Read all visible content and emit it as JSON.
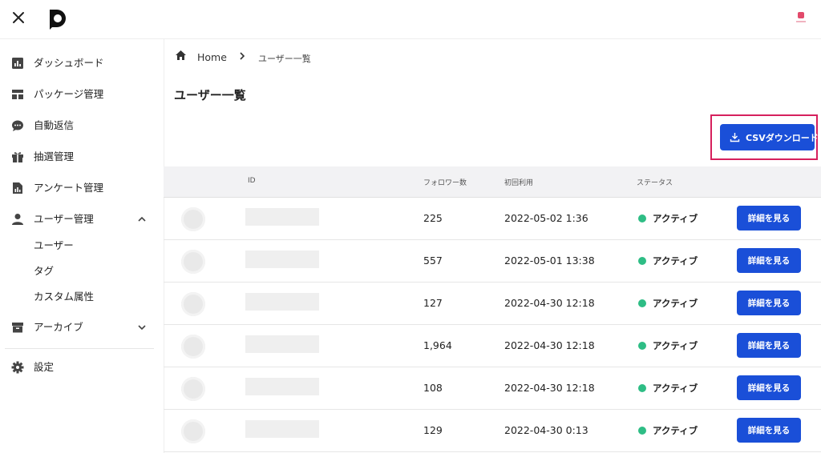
{
  "header": {
    "close_icon": "close-icon",
    "logo_icon": "app-logo",
    "account_icon": "account-logo"
  },
  "sidebar": {
    "items": [
      {
        "label": "ダッシュボード",
        "icon": "chart-icon"
      },
      {
        "label": "パッケージ管理",
        "icon": "layout-icon"
      },
      {
        "label": "自動返信",
        "icon": "chat-icon"
      },
      {
        "label": "抽選管理",
        "icon": "gift-icon"
      },
      {
        "label": "アンケート管理",
        "icon": "survey-icon"
      },
      {
        "label": "ユーザー管理",
        "icon": "person-icon"
      },
      {
        "label": "アーカイブ",
        "icon": "archive-icon"
      },
      {
        "label": "設定",
        "icon": "gear-icon"
      }
    ],
    "sub_items": [
      "ユーザー",
      "タグ",
      "カスタム属性"
    ]
  },
  "breadcrumb": {
    "home": "Home",
    "current": "ユーザー一覧"
  },
  "page": {
    "title": "ユーザー一覧",
    "csv_button": "CSVダウンロード"
  },
  "table": {
    "headers": [
      "ID",
      "フォロワー数",
      "初回利用",
      "ステータス"
    ],
    "rows": [
      {
        "followers": "225",
        "first_use": "2022-05-02 1:36",
        "status": "アクティブ",
        "action": "詳細を見る"
      },
      {
        "followers": "557",
        "first_use": "2022-05-01 13:38",
        "status": "アクティブ",
        "action": "詳細を見る"
      },
      {
        "followers": "127",
        "first_use": "2022-04-30 12:18",
        "status": "アクティブ",
        "action": "詳細を見る"
      },
      {
        "followers": "1,964",
        "first_use": "2022-04-30 12:18",
        "status": "アクティブ",
        "action": "詳細を見る"
      },
      {
        "followers": "108",
        "first_use": "2022-04-30 12:18",
        "status": "アクティブ",
        "action": "詳細を見る"
      },
      {
        "followers": "129",
        "first_use": "2022-04-30 0:13",
        "status": "アクティブ",
        "action": "詳細を見る"
      }
    ]
  },
  "colors": {
    "accent": "#1a4fd8",
    "status_active": "#2ebd85",
    "highlight": "#d6205d"
  }
}
